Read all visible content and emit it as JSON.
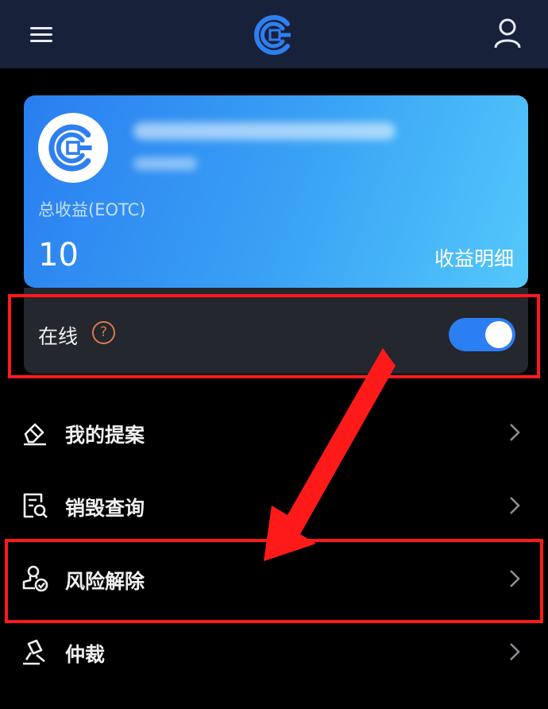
{
  "colors": {
    "topbar": "#18213a",
    "accent": "#2c7ef3",
    "highlight": "#ff1a1a",
    "help": "#d87a4e"
  },
  "header": {
    "menu_icon": "hamburger-menu-icon",
    "logo_icon": "eotc-logo-icon",
    "user_icon": "user-icon"
  },
  "card": {
    "earnings_label": "总收益(EOTC)",
    "earnings_value": "10",
    "detail_link": "收益明细"
  },
  "status": {
    "label": "在线",
    "help_glyph": "?",
    "online": true
  },
  "menu": [
    {
      "label": "我的提案",
      "icon": "eraser-icon"
    },
    {
      "label": "销毁查询",
      "icon": "document-search-icon"
    },
    {
      "label": "风险解除",
      "icon": "stamp-check-icon"
    },
    {
      "label": "仲裁",
      "icon": "gavel-icon"
    }
  ]
}
